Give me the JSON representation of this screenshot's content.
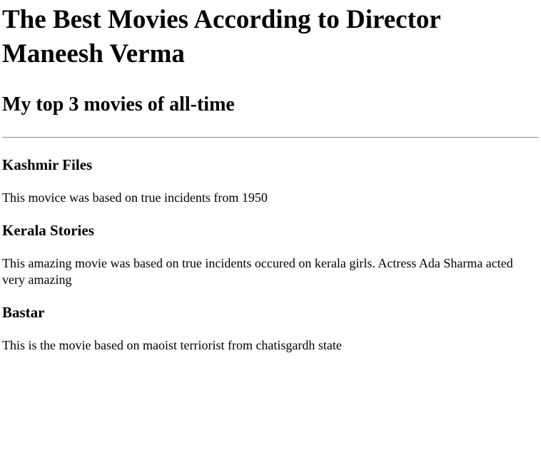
{
  "page": {
    "title": "The Best Movies According to Director Maneesh Verma",
    "subtitle": "My top 3 movies of all-time"
  },
  "movies": [
    {
      "title": "Kashmir Files",
      "description": "This movice was based on true incidents from 1950"
    },
    {
      "title": "Kerala Stories",
      "description": "This amazing movie was based on true incidents occured on kerala girls. Actress Ada Sharma acted very amazing"
    },
    {
      "title": "Bastar",
      "description": "This is the movie based on maoist terriorist from chatisgardh state"
    }
  ]
}
